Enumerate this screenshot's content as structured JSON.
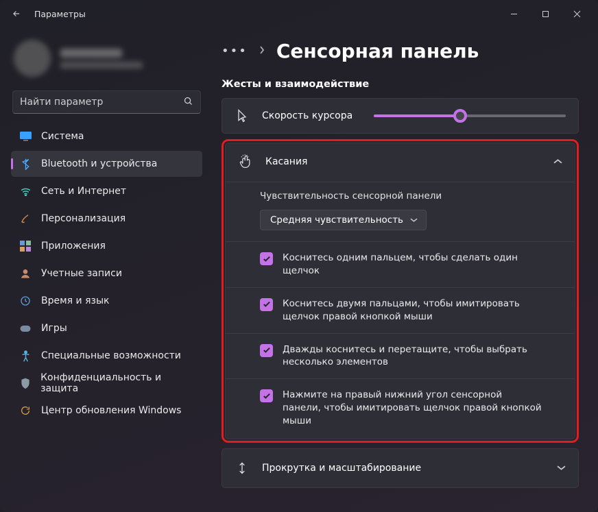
{
  "window": {
    "title": "Параметры"
  },
  "search": {
    "placeholder": "Найти параметр"
  },
  "nav": [
    {
      "label": "Система"
    },
    {
      "label": "Bluetooth и устройства"
    },
    {
      "label": "Сеть и Интернет"
    },
    {
      "label": "Персонализация"
    },
    {
      "label": "Приложения"
    },
    {
      "label": "Учетные записи"
    },
    {
      "label": "Время и язык"
    },
    {
      "label": "Игры"
    },
    {
      "label": "Специальные возможности"
    },
    {
      "label": "Конфиденциальность и защита"
    },
    {
      "label": "Центр обновления Windows"
    }
  ],
  "page": {
    "title": "Сенсорная панель",
    "section": "Жесты и взаимодействие",
    "cursor_speed_label": "Скорость курсора",
    "cursor_speed_pct": 45
  },
  "taps": {
    "header": "Касания",
    "sensitivity_label": "Чувствительность сенсорной панели",
    "sensitivity_value": "Средняя чувствительность",
    "options": [
      "Коснитесь одним пальцем, чтобы сделать один щелчок",
      "Коснитесь двумя пальцами, чтобы имитировать щелчок правой кнопкой мыши",
      "Дважды коснитесь и перетащите, чтобы выбрать несколько элементов",
      "Нажмите на правый нижний угол сенсорной панели, чтобы имитировать щелчок правой кнопкой мыши"
    ]
  },
  "scroll": {
    "header": "Прокрутка и масштабирование"
  }
}
